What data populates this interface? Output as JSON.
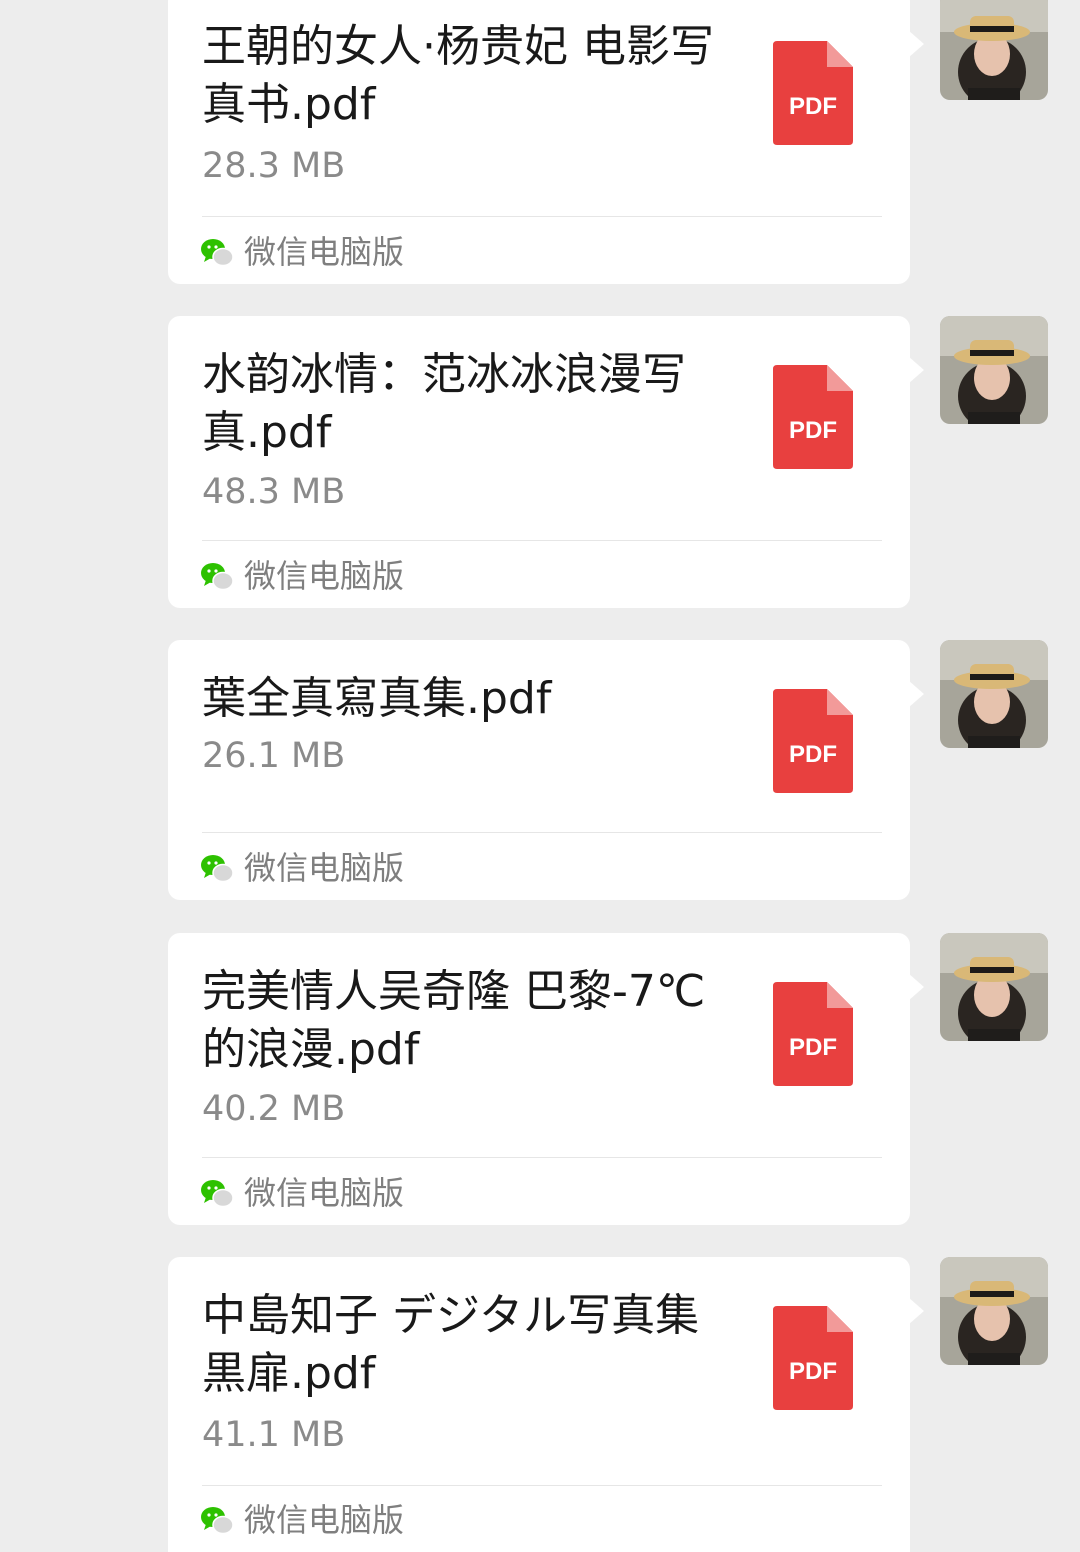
{
  "messages": [
    {
      "file_name": "王朝的女人·杨贵妃 电影写真书.pdf",
      "file_size": "28.3 MB",
      "file_type": "PDF",
      "source": "微信电脑版"
    },
    {
      "file_name": "水韵冰情：范冰冰浪漫写真.pdf",
      "file_size": "48.3 MB",
      "file_type": "PDF",
      "source": "微信电脑版"
    },
    {
      "file_name": "葉全真寫真集.pdf",
      "file_size": "26.1 MB",
      "file_type": "PDF",
      "source": "微信电脑版"
    },
    {
      "file_name": "完美情人吴奇隆 巴黎-7℃的浪漫.pdf",
      "file_size": "40.2 MB",
      "file_type": "PDF",
      "source": "微信电脑版"
    },
    {
      "file_name": "中島知子 デジタル写真集 黒扉.pdf",
      "file_size": "41.1 MB",
      "file_type": "PDF",
      "source": "微信电脑版"
    }
  ],
  "icons": {
    "file": "pdf-file-icon",
    "source": "wechat-icon",
    "avatar": "user-avatar"
  },
  "colors": {
    "background": "#ededed",
    "bubble": "#ffffff",
    "pdf_red": "#e8403f",
    "pdf_fold": "#f29a99",
    "wechat_green": "#2dc100",
    "meta_gray": "#8a8a8a"
  }
}
